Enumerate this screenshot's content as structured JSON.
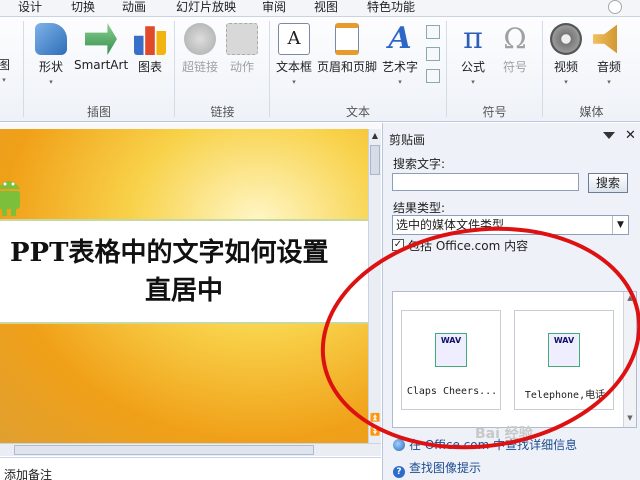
{
  "tabs": [
    "设计",
    "切换",
    "动画",
    "幻灯片放映",
    "审阅",
    "视图",
    "特色功能"
  ],
  "ribbon": {
    "left_stub": "图",
    "groups": [
      {
        "label": "插图",
        "buttons": [
          {
            "label": "形状"
          },
          {
            "label": "SmartArt"
          },
          {
            "label": "图表"
          }
        ]
      },
      {
        "label": "链接",
        "buttons": [
          {
            "label": "超链接"
          },
          {
            "label": "动作"
          }
        ]
      },
      {
        "label": "文本",
        "buttons": [
          {
            "label": "文本框"
          },
          {
            "label": "页眉和页脚"
          },
          {
            "label": "艺术字"
          }
        ]
      },
      {
        "label": "符号",
        "buttons": [
          {
            "label": "公式"
          },
          {
            "label": "符号"
          }
        ]
      },
      {
        "label": "媒体",
        "buttons": [
          {
            "label": "视频"
          },
          {
            "label": "音频"
          }
        ]
      }
    ]
  },
  "slide": {
    "title_line1": "PPT表格中的文字如何设置",
    "title_line2": "直居中"
  },
  "notes_placeholder": "添加备注",
  "clip_pane": {
    "title": "剪贴画",
    "search_label": "搜索文字:",
    "search_value": "",
    "search_button": "搜索",
    "type_label": "结果类型:",
    "type_value": "选中的媒体文件类型",
    "include_office_label": "包括 Office.com 内容",
    "include_office_checked": true,
    "results": [
      {
        "name": "Claps Cheers...",
        "badge": "WAV"
      },
      {
        "name": "Telephone,电话",
        "badge": "WAV"
      }
    ],
    "link_office": "在 Office.com 中查找详细信息",
    "link_help": "查找图像提示"
  },
  "watermark": "Bai 经验",
  "colors": {
    "annotation": "#d11111",
    "link": "#1d4b8f"
  }
}
